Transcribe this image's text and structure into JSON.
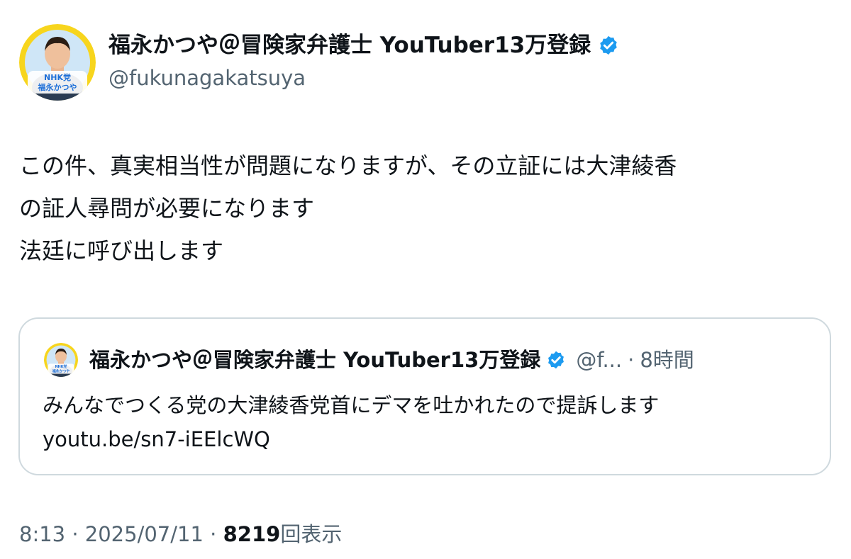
{
  "author": {
    "name": "福永かつや＠冒険家弁護士 YouTuber13万登録",
    "handle": "@fukunagakatsuya",
    "avatar_text_top": "NHK党",
    "avatar_text_bottom": "福永かつや",
    "verified_icon": "verified-badge-icon",
    "badge_color": "#1d9bf0"
  },
  "tweet": {
    "text": "この件、真実相当性が問題になりますが、その立証には大津綾香\nの証人尋問が必要になります\n法廷に呼び出します"
  },
  "quote": {
    "name": "福永かつや＠冒険家弁護士 YouTuber13万登録",
    "handle": "@f...",
    "separator": "·",
    "time": "8時間",
    "text_line1": "みんなでつくる党の大津綾香党首にデマを吐かれたので提訴します",
    "link": "youtu.be/sn7-iEElcWQ"
  },
  "meta": {
    "time": "8:13",
    "date": "2025/07/11",
    "separator": "·",
    "views_count": "8219",
    "views_label": "回表示"
  }
}
